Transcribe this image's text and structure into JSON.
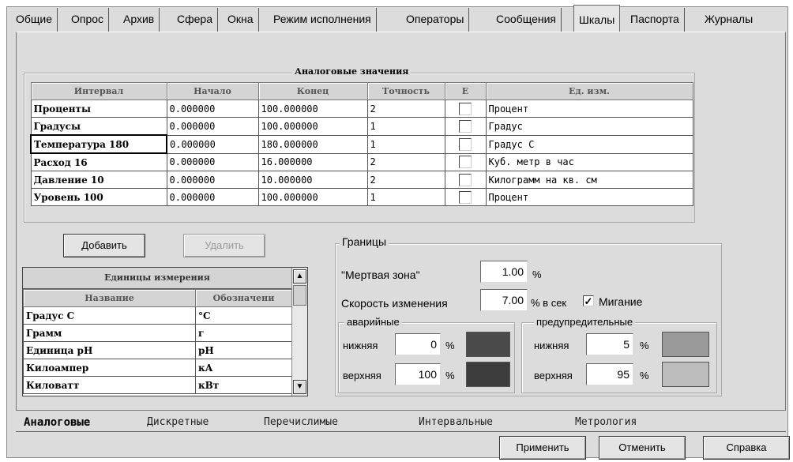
{
  "top_tabs": [
    "Общие",
    "Опрос",
    "Архив",
    "Сфера",
    "Окна",
    "Режим исполнения",
    "Операторы",
    "Сообщения",
    "Шкалы",
    "Паспорта",
    "Журналы"
  ],
  "analog": {
    "title": "Аналоговые значения",
    "headers": [
      "Интервал",
      "Начало",
      "Конец",
      "Точность",
      "Е",
      "Ед. изм."
    ],
    "rows": [
      {
        "name": "Проценты",
        "start": "0.000000",
        "end": "100.000000",
        "prec": "2",
        "unit": "Процент"
      },
      {
        "name": "Градусы",
        "start": "0.000000",
        "end": "100.000000",
        "prec": "1",
        "unit": "Градус"
      },
      {
        "name": "Температура 180",
        "start": "0.000000",
        "end": "180.000000",
        "prec": "1",
        "unit": "Градус C"
      },
      {
        "name": "Расход 16",
        "start": "0.000000",
        "end": "16.000000",
        "prec": "2",
        "unit": "Куб. метр в час"
      },
      {
        "name": "Давление 10",
        "start": "0.000000",
        "end": "10.000000",
        "prec": "2",
        "unit": "Килограмм на кв. см"
      },
      {
        "name": "Уровень 100",
        "start": "0.000000",
        "end": "100.000000",
        "prec": "1",
        "unit": "Процент"
      }
    ]
  },
  "buttons": {
    "add": "Добавить",
    "delete": "Удалить",
    "apply": "Применить",
    "cancel": "Отменить",
    "help": "Справка"
  },
  "units_table": {
    "title": "Единицы измерения",
    "headers": [
      "Название",
      "Обозначени"
    ],
    "rows": [
      {
        "name": "Градус C",
        "sym": "°C"
      },
      {
        "name": "Грамм",
        "sym": "г"
      },
      {
        "name": "Единица pH",
        "sym": "pH"
      },
      {
        "name": "Килоампер",
        "sym": "кА"
      },
      {
        "name": "Киловатт",
        "sym": "кВт"
      }
    ]
  },
  "limits": {
    "title": "Границы",
    "deadzone_label": "\"Мертвая зона\"",
    "deadzone_value": "1.00",
    "deadzone_unit": "%",
    "rate_label": "Скорость изменения",
    "rate_value": "7.00",
    "rate_unit": "% в сек",
    "blink_label": "Мигание",
    "alarm": {
      "title": "аварийные",
      "low_label": "нижняя",
      "low_value": "0",
      "high_label": "верхняя",
      "high_value": "100",
      "unit": "%",
      "low_color": "#4a4a4a",
      "high_color": "#3c3c3c"
    },
    "warn": {
      "title": "предупредительные",
      "low_label": "нижняя",
      "low_value": "5",
      "high_label": "верхняя",
      "high_value": "95",
      "unit": "%",
      "low_color": "#9a9a9a",
      "high_color": "#bcbcbc"
    }
  },
  "bottom_tabs": [
    "Аналоговые",
    "Дискретные",
    "Перечислимые",
    "Интервальные",
    "Метрология"
  ]
}
